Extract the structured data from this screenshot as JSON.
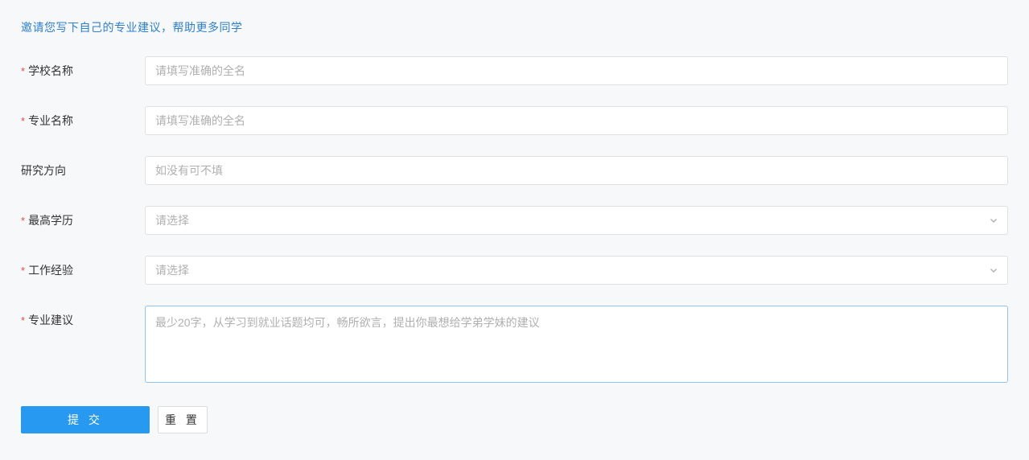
{
  "header": {
    "title": "邀请您写下自己的专业建议，帮助更多同学"
  },
  "fields": {
    "school": {
      "label": "学校名称",
      "placeholder": "请填写准确的全名",
      "required": true
    },
    "major": {
      "label": "专业名称",
      "placeholder": "请填写准确的全名",
      "required": true
    },
    "research": {
      "label": "研究方向",
      "placeholder": "如没有可不填",
      "required": false
    },
    "education": {
      "label": "最高学历",
      "placeholder": "请选择",
      "required": true
    },
    "experience": {
      "label": "工作经验",
      "placeholder": "请选择",
      "required": true
    },
    "suggestion": {
      "label": "专业建议",
      "placeholder": "最少20字，从学习到就业话题均可，畅所欲言，提出你最想给学弟学妹的建议",
      "required": true
    }
  },
  "buttons": {
    "submit": "提 交",
    "reset": "重 置"
  }
}
